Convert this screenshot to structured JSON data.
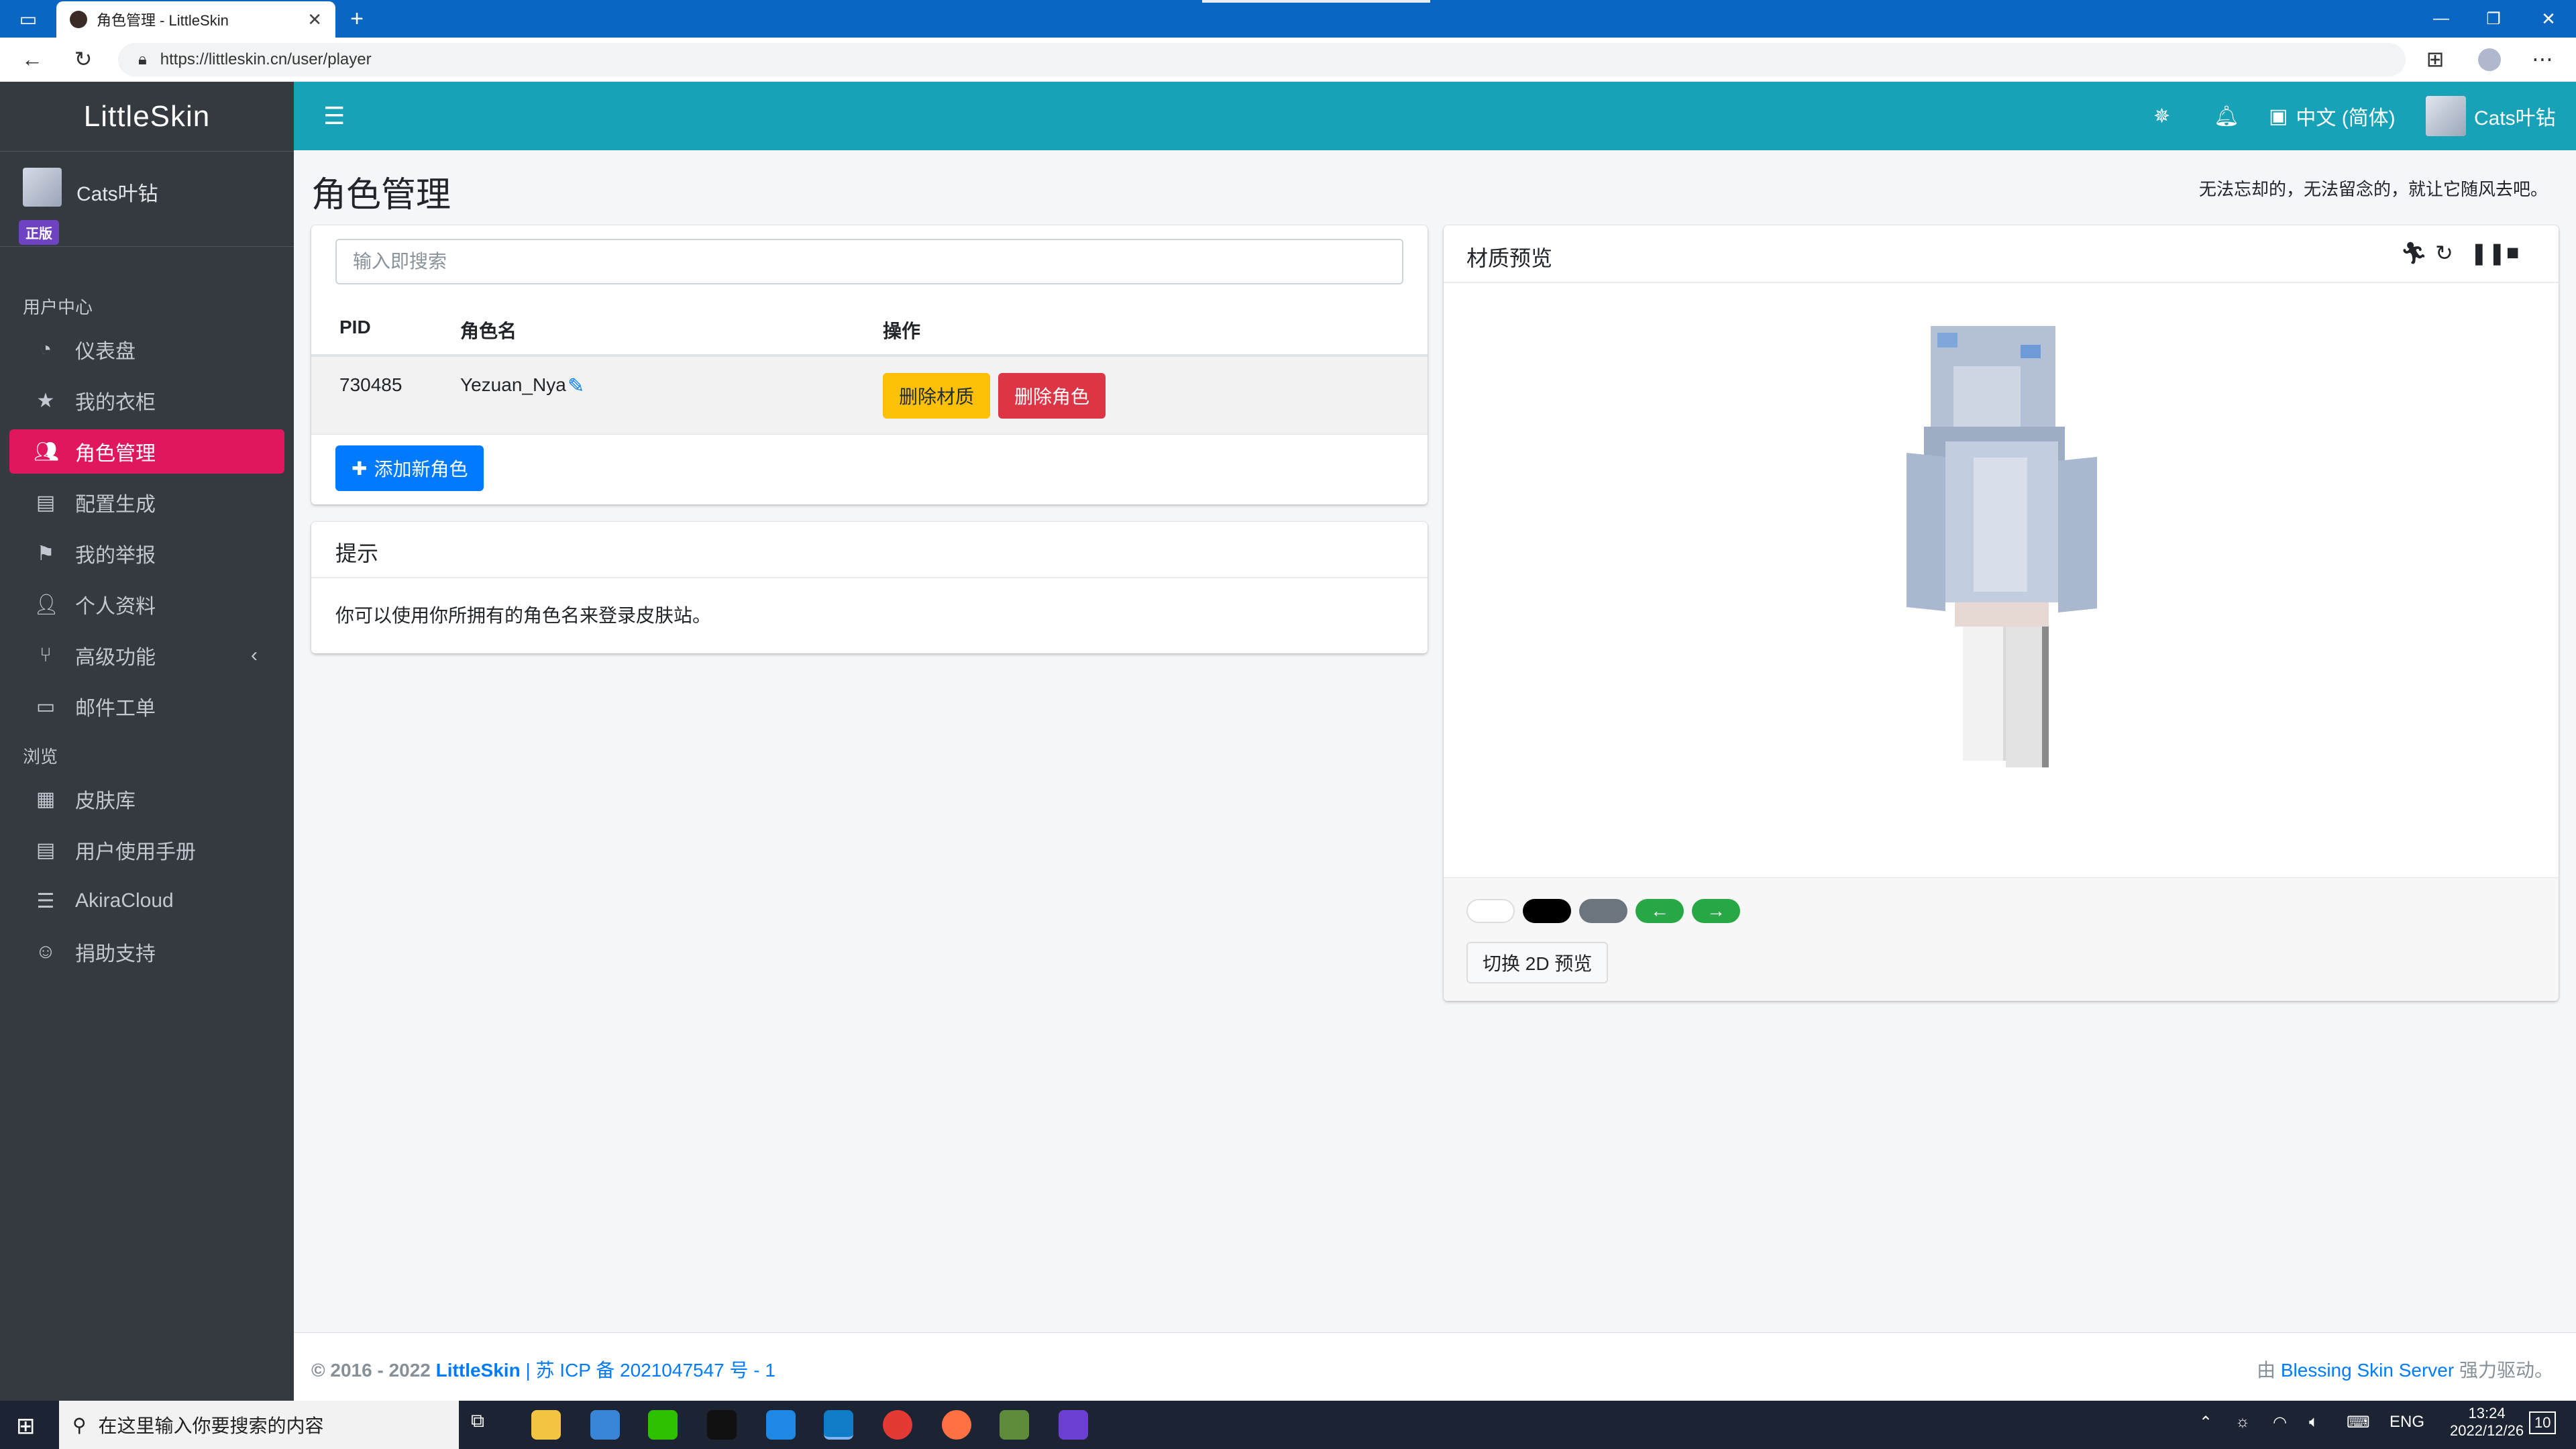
{
  "browser": {
    "tab_title": "角色管理 - LittleSkin",
    "url": "https://littleskin.cn/user/player",
    "new_tab_label": "+"
  },
  "sidebar": {
    "brand": "LittleSkin",
    "user_name": "Cats叶钻",
    "user_badge": "正版",
    "section_user": "用户中心",
    "section_browse": "浏览",
    "items": [
      {
        "label": "仪表盘",
        "icon": "dashboard-icon"
      },
      {
        "label": "我的衣柜",
        "icon": "star-icon"
      },
      {
        "label": "角色管理",
        "icon": "users-icon"
      },
      {
        "label": "配置生成",
        "icon": "book-icon"
      },
      {
        "label": "我的举报",
        "icon": "flag-icon"
      },
      {
        "label": "个人资料",
        "icon": "user-icon"
      },
      {
        "label": "高级功能",
        "icon": "branch-icon"
      },
      {
        "label": "邮件工单",
        "icon": "ticket-icon"
      }
    ],
    "browse_items": [
      {
        "label": "皮肤库",
        "icon": "archive-icon"
      },
      {
        "label": "用户使用手册",
        "icon": "book-icon"
      },
      {
        "label": "AkiraCloud",
        "icon": "server-icon"
      },
      {
        "label": "捐助支持",
        "icon": "donate-icon"
      }
    ]
  },
  "topnav": {
    "language": "中文 (简体)",
    "user_name": "Cats叶钻"
  },
  "page": {
    "title": "角色管理",
    "slogan": "无法忘却的，无法留念的，就让它随风去吧。"
  },
  "players": {
    "search_placeholder": "输入即搜索",
    "headers": {
      "pid": "PID",
      "name": "角色名",
      "actions": "操作"
    },
    "rows": [
      {
        "pid": "730485",
        "name": "Yezuan_Nya",
        "delete_texture": "删除材质",
        "delete_player": "删除角色"
      }
    ],
    "add_button": "添加新角色"
  },
  "tips": {
    "title": "提示",
    "body": "你可以使用你所拥有的角色名来登录皮肤站。"
  },
  "preview": {
    "title": "材质预览",
    "switch_2d": "切换 2D 预览",
    "swatch_colors": [
      "#ffffff",
      "#000000",
      "#6c757d"
    ],
    "accent": "#28a745"
  },
  "footer": {
    "copyright": "© 2016 - 2022",
    "site": "LittleSkin",
    "icp": "| 苏 ICP 备 2021047547 号 - 1",
    "powered_prefix": "由",
    "powered_link": "Blessing Skin Server",
    "powered_suffix": "强力驱动。"
  },
  "taskbar": {
    "search_placeholder": "在这里输入你要搜索的内容",
    "ime": "ENG",
    "time": "13:24",
    "date": "2022/12/26",
    "notifications": "10"
  },
  "colors": {
    "sidebar_bg": "#343a40",
    "topnav_bg": "#17a2b8",
    "active_item": "#e0175e",
    "primary": "#007bff",
    "warning": "#ffc107",
    "danger": "#dc3545"
  }
}
